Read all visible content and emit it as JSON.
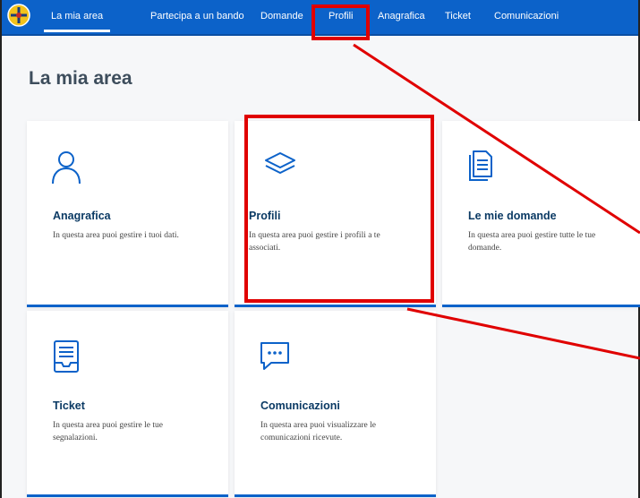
{
  "nav": {
    "items": [
      {
        "label": "La mia area",
        "active": true
      },
      {
        "label": "Partecipa a un bando"
      },
      {
        "label": "Domande"
      },
      {
        "label": "Profili"
      },
      {
        "label": "Anagrafica"
      },
      {
        "label": "Ticket"
      },
      {
        "label": "Comunicazioni"
      }
    ]
  },
  "page": {
    "title": "La mia area"
  },
  "cards": [
    {
      "icon": "user-icon",
      "title": "Anagrafica",
      "desc": "In questa area puoi gestire i tuoi dati."
    },
    {
      "icon": "layers-icon",
      "title": "Profili",
      "desc": "In questa area puoi gestire i profili a te associati."
    },
    {
      "icon": "document-icon",
      "title": "Le mie domande",
      "desc": "In questa area puoi gestire tutte le tue domande."
    },
    {
      "icon": "inbox-icon",
      "title": "Ticket",
      "desc": "In questa area puoi gestire le tue segnalazioni."
    },
    {
      "icon": "chat-icon",
      "title": "Comunicazioni",
      "desc": "In questa area puoi visualizzare le comunicazioni ricevute."
    }
  ],
  "colors": {
    "primary": "#0c62c9",
    "title": "#0b3a64",
    "annotation": "#e00000"
  }
}
